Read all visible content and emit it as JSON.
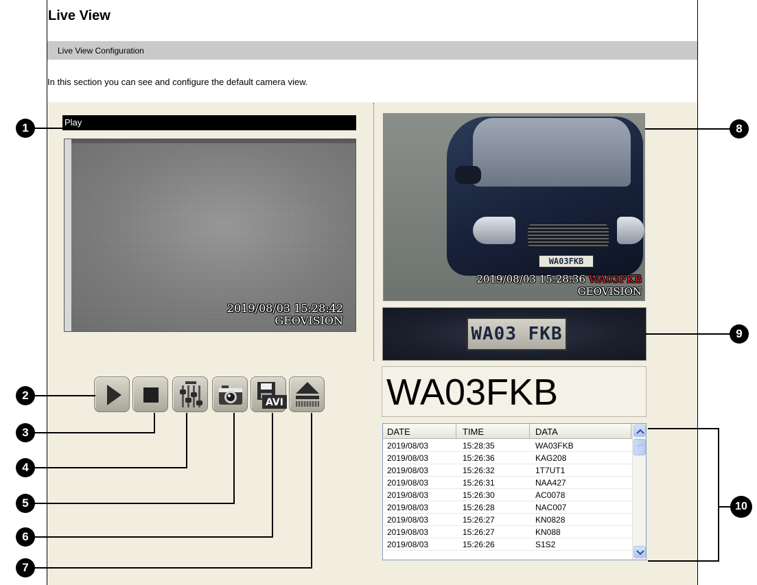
{
  "page": {
    "title": "Live View",
    "section": "Live View Configuration",
    "intro": "In this section you can see and configure the default camera view."
  },
  "live_video": {
    "status": "Play",
    "timestamp": "2019/08/03 15:28:42",
    "brand": "GEOVISION"
  },
  "controls": [
    {
      "name": "play",
      "icon": "play-icon"
    },
    {
      "name": "stop",
      "icon": "stop-icon"
    },
    {
      "name": "settings",
      "icon": "sliders-icon"
    },
    {
      "name": "snapshot",
      "icon": "camera-icon"
    },
    {
      "name": "record-avi",
      "icon": "save-avi-icon"
    },
    {
      "name": "eject",
      "icon": "eject-icon"
    }
  ],
  "capture": {
    "plate_on_car": "WA03FKB",
    "timestamp": "2019/08/03 15:28:36",
    "plate_overlay": "WA03FKB",
    "brand": "GEOVISION",
    "plate_crop_text": "WA03 FKB",
    "recognized_plate": "WA03FKB"
  },
  "log": {
    "headers": [
      "DATE",
      "TIME",
      "DATA"
    ],
    "rows": [
      [
        "2019/08/03",
        "15:28:35",
        "WA03FKB"
      ],
      [
        "2019/08/03",
        "15:26:36",
        "KAG208"
      ],
      [
        "2019/08/03",
        "15:26:32",
        "1T7UT1"
      ],
      [
        "2019/08/03",
        "15:26:31",
        "NAA427"
      ],
      [
        "2019/08/03",
        "15:26:30",
        "AC0078"
      ],
      [
        "2019/08/03",
        "15:26:28",
        "NAC007"
      ],
      [
        "2019/08/03",
        "15:26:27",
        "KN0828"
      ],
      [
        "2019/08/03",
        "15:26:27",
        "KN088"
      ],
      [
        "2019/08/03",
        "15:26:26",
        "S1S2"
      ]
    ]
  },
  "callouts": [
    "1",
    "2",
    "3",
    "4",
    "5",
    "6",
    "7",
    "8",
    "9",
    "10"
  ],
  "colors": {
    "panel_bg": "#f1eee0",
    "section_bar": "#c9c9c9",
    "plate_overlay": "#e02a2a"
  }
}
